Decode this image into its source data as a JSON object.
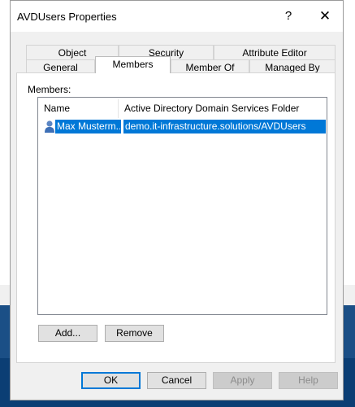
{
  "dialog": {
    "title": "AVDUsers Properties",
    "help_glyph": "?",
    "close_glyph": "✕"
  },
  "tabs_row1": [
    "Object",
    "Security",
    "Attribute Editor"
  ],
  "tabs_row2": [
    "General",
    "Members",
    "Member Of",
    "Managed By"
  ],
  "active_tab": "Members",
  "members": {
    "label": "Members:",
    "columns": [
      "Name",
      "Active Directory Domain Services Folder"
    ],
    "rows": [
      {
        "name": "Max Musterm...",
        "folder": "demo.it-infrastructure.solutions/AVDUsers",
        "icon": "user-icon",
        "selected": true
      }
    ],
    "add_label": "Add...",
    "remove_label": "Remove"
  },
  "footer": {
    "ok_label": "OK",
    "cancel_label": "Cancel",
    "apply_label": "Apply",
    "help_label": "Help"
  },
  "colors": {
    "selection": "#0078d7",
    "dialog_bg": "#f0f0f0",
    "desktop": "#1b4f86"
  }
}
